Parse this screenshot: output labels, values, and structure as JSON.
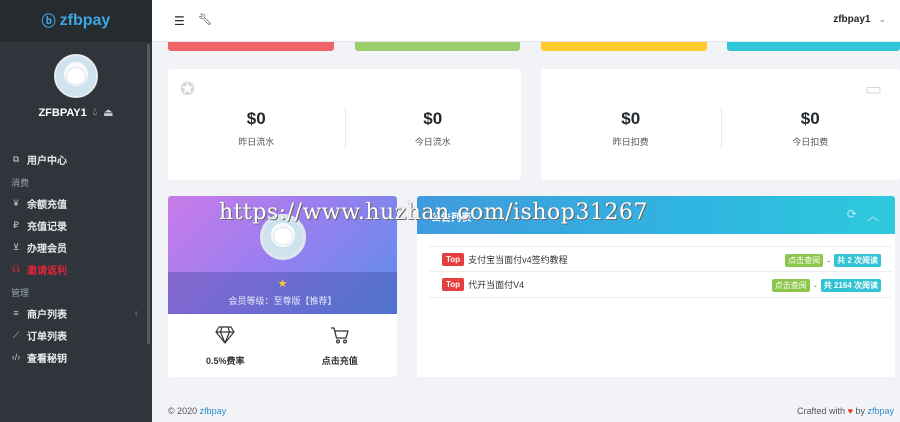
{
  "brand": {
    "logo_text": "zfbpay"
  },
  "sidebar": {
    "username": "ZFBPAY1",
    "nav": [
      {
        "type": "item",
        "label": "用户中心",
        "icon": "home-icon"
      },
      {
        "type": "title",
        "label": "消费"
      },
      {
        "type": "item",
        "label": "余额充值",
        "icon": "yen-icon"
      },
      {
        "type": "item",
        "label": "充值记录",
        "icon": "ruble-icon"
      },
      {
        "type": "item",
        "label": "办理会员",
        "icon": "cart-icon"
      },
      {
        "type": "item",
        "label": "邀请返利",
        "icon": "headset-icon",
        "highlight": "#e2233a"
      },
      {
        "type": "title",
        "label": "管理"
      },
      {
        "type": "item",
        "label": "商户列表",
        "icon": "list-icon",
        "has_children": true
      },
      {
        "type": "item",
        "label": "订单列表",
        "icon": "chart-icon"
      },
      {
        "type": "item",
        "label": "查看秘钥",
        "icon": "code-icon"
      }
    ]
  },
  "header": {
    "user_label": "zfbpay1"
  },
  "stats_left": [
    {
      "value": "$0",
      "label": "昨日流水"
    },
    {
      "value": "$0",
      "label": "今日流水"
    }
  ],
  "stats_right": [
    {
      "value": "$0",
      "label": "昨日扣费"
    },
    {
      "value": "$0",
      "label": "今日扣费"
    }
  ],
  "member": {
    "level_text": "会员等级：至尊版【推荐】",
    "rate_label": "0.5%费率",
    "recharge_label": "点击充值"
  },
  "notices": {
    "title": "公告列表",
    "items": [
      {
        "badge": "Top",
        "title": "支付宝当面付v4签约教程",
        "action": "点击查阅",
        "sep": "-",
        "reads": "共 2 次阅读"
      },
      {
        "badge": "Top",
        "title": "代开当面付V4",
        "action": "点击查阅",
        "sep": "-",
        "reads": "共 2164 次阅读"
      }
    ]
  },
  "footer": {
    "copyright": "© 2020",
    "brand": "zfbpay",
    "crafted": "Crafted with",
    "by": "by",
    "by_brand": "zfbpay"
  },
  "watermark": "https://www.huzhan.com/ishop31267",
  "colors": {
    "sidebar_bg": "#2f353b",
    "strip_red": "#f06467",
    "strip_green": "#9bcf6d",
    "strip_yellow": "#ffcb2b",
    "strip_cyan": "#2fc6d5",
    "accent": "#2e8bd0"
  }
}
